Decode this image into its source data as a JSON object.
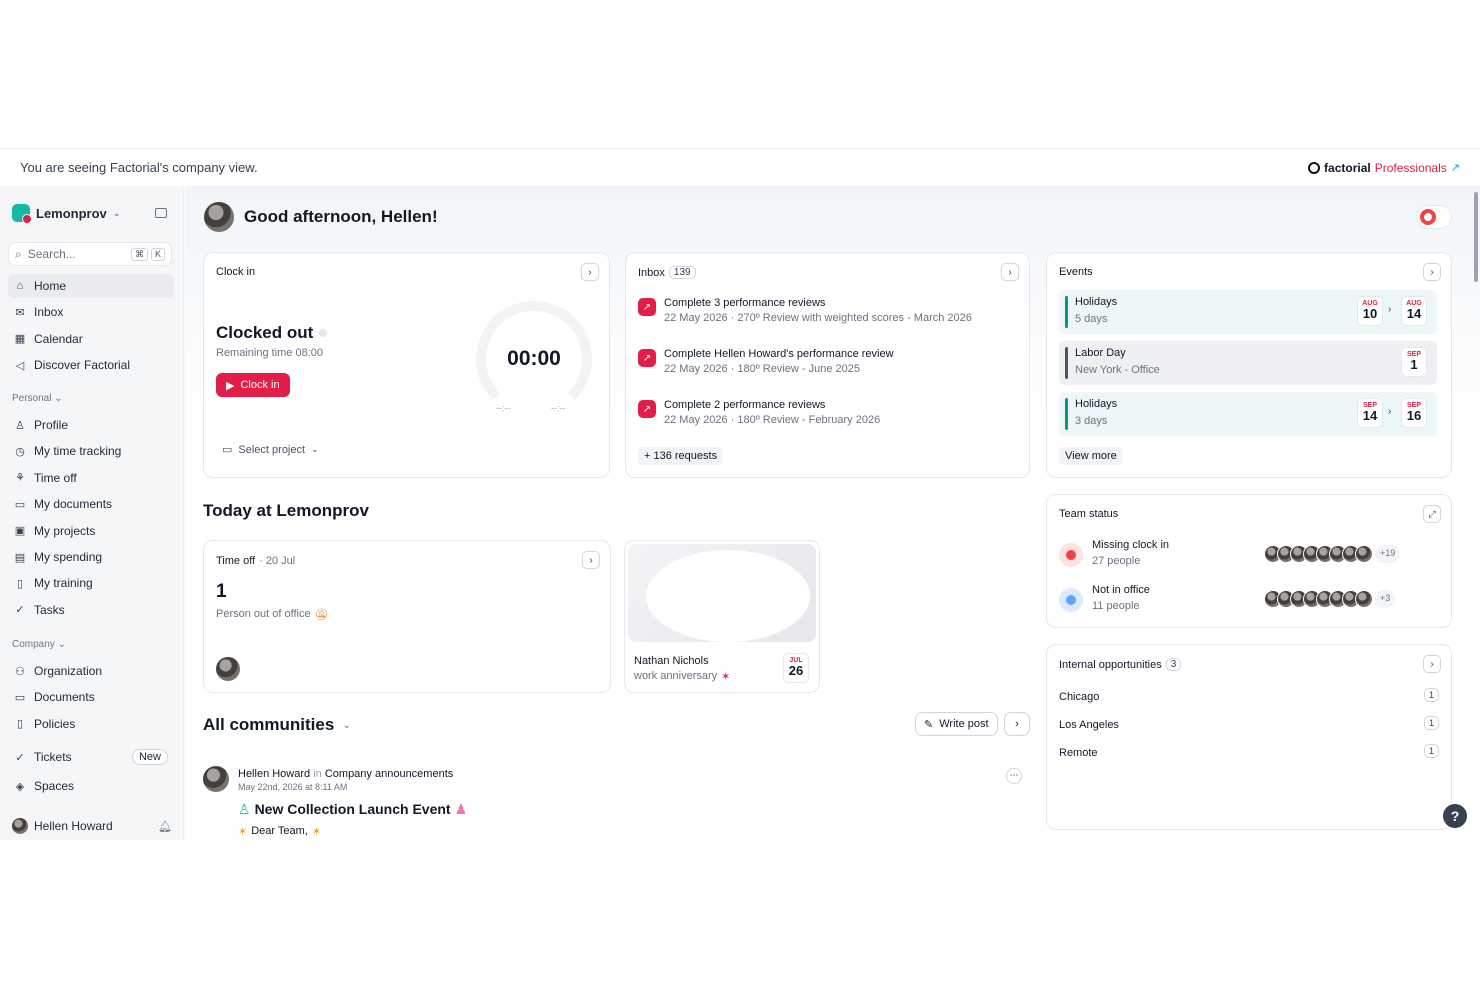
{
  "banner": {
    "text": "You are seeing Factorial's company view.",
    "brand": "factorial",
    "brand_suffix": "Professionals"
  },
  "sidebar": {
    "workspace": "Lemonprov",
    "search_placeholder": "Search...",
    "search_keys": [
      "⌘",
      "K"
    ],
    "main_items": [
      {
        "label": "Home",
        "icon": "home-icon"
      },
      {
        "label": "Inbox",
        "icon": "inbox-icon"
      },
      {
        "label": "Calendar",
        "icon": "calendar-icon"
      },
      {
        "label": "Discover Factorial",
        "icon": "megaphone-icon"
      }
    ],
    "personal_label": "Personal",
    "personal_items": [
      {
        "label": "Profile",
        "icon": "person-icon"
      },
      {
        "label": "My time tracking",
        "icon": "clock-icon"
      },
      {
        "label": "Time off",
        "icon": "palm-icon"
      },
      {
        "label": "My documents",
        "icon": "folder-icon"
      },
      {
        "label": "My projects",
        "icon": "briefcase-icon"
      },
      {
        "label": "My spending",
        "icon": "wallet-icon"
      },
      {
        "label": "My training",
        "icon": "book-icon"
      },
      {
        "label": "Tasks",
        "icon": "check-circle-icon"
      }
    ],
    "company_label": "Company",
    "company_items": [
      {
        "label": "Organization",
        "icon": "people-icon"
      },
      {
        "label": "Documents",
        "icon": "folder-icon"
      },
      {
        "label": "Policies",
        "icon": "file-icon"
      },
      {
        "label": "Tickets",
        "icon": "check-circle-icon",
        "badge": "New"
      },
      {
        "label": "Spaces",
        "icon": "cube-icon"
      }
    ],
    "user_name": "Hellen Howard"
  },
  "header": {
    "greeting": "Good afternoon, Hellen!"
  },
  "clockin": {
    "title": "Clock in",
    "status": "Clocked out",
    "remaining": "Remaining time 08:00",
    "button": "Clock in",
    "time": "00:00",
    "start": "--:--",
    "end": "--:--",
    "project": "Select project"
  },
  "inbox": {
    "title": "Inbox",
    "count": "139",
    "items": [
      {
        "title": "Complete 3 performance reviews",
        "sub": "22 May 2026 · 270º Review with weighted scores - March 2026"
      },
      {
        "title": "Complete Hellen Howard's performance review",
        "sub": "22 May 2026 · 180º Review - June 2025"
      },
      {
        "title": "Complete 2 performance reviews",
        "sub": "22 May 2026 · 180º Review - February 2026"
      }
    ],
    "more": "+ 136 requests"
  },
  "events": {
    "title": "Events",
    "items": [
      {
        "name": "Holidays",
        "detail": "5 days",
        "from_m": "AUG",
        "from_d": "10",
        "to_m": "AUG",
        "to_d": "14"
      },
      {
        "name": "Labor Day",
        "detail": "New York - Office",
        "from_m": "SEP",
        "from_d": "1"
      },
      {
        "name": "Holidays",
        "detail": "3 days",
        "from_m": "SEP",
        "from_d": "14",
        "to_m": "SEP",
        "to_d": "16"
      }
    ],
    "view_more": "View more"
  },
  "today": {
    "title": "Today at Lemonprov",
    "timeoff_label": "Time off",
    "timeoff_date": "· 20 Jul",
    "count": "1",
    "desc": "Person out of office",
    "anniv_name": "Nathan Nichols",
    "anniv_desc": "work anniversary",
    "anniv_m": "JUL",
    "anniv_d": "26"
  },
  "team_status": {
    "title": "Team status",
    "rows": [
      {
        "name": "Missing clock in",
        "people": "27 people",
        "more": "+19",
        "color": "#ef4444",
        "bg": "#fee2e2"
      },
      {
        "name": "Not in office",
        "people": "11 people",
        "more": "+3",
        "color": "#60a5fa",
        "bg": "#dbeafe"
      }
    ]
  },
  "opportunities": {
    "title": "Internal opportunities",
    "count": "3",
    "items": [
      {
        "name": "Chicago",
        "count": "1"
      },
      {
        "name": "Los Angeles",
        "count": "1"
      },
      {
        "name": "Remote",
        "count": "1"
      }
    ]
  },
  "communities": {
    "title": "All communities",
    "write": "Write post",
    "post_author": "Hellen Howard",
    "post_in": "in",
    "post_channel": "Company announcements",
    "post_date": "May 22nd, 2026 at 8:11 AM",
    "post_title": "New Collection Launch Event",
    "post_body": "Dear Team,"
  },
  "colors": {
    "accent": "#e11d48",
    "teal": "#14b8a6"
  }
}
